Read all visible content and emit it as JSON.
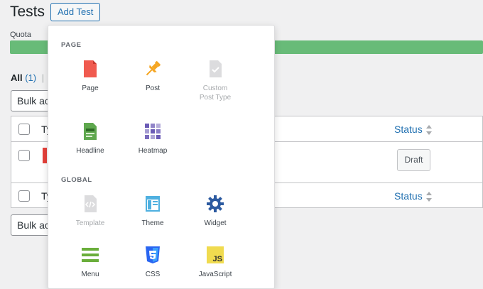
{
  "page": {
    "title": "Tests",
    "add_button": "Add Test",
    "quota_label": "Quota",
    "filters": {
      "all": "All",
      "count": "(1)",
      "separator": "|"
    },
    "bulk_label": "Bulk ac"
  },
  "table": {
    "col_type": "Ty",
    "col_status": "Status",
    "row_status": "Draft"
  },
  "dropdown": {
    "sections": [
      {
        "title": "PAGE",
        "items": [
          {
            "label": "Page",
            "icon": "page-icon",
            "color": "#f05a4f"
          },
          {
            "label": "Post",
            "icon": "pushpin-icon",
            "color": "#f5a623"
          },
          {
            "label": "Custom\nPost Type",
            "icon": "custom-post-type-icon",
            "color": "#dcdcde",
            "disabled": true
          },
          {
            "label": "Headline",
            "icon": "headline-icon",
            "color": "#5fa84e"
          },
          {
            "label": "Heatmap",
            "icon": "heatmap-icon",
            "color": "#6b5bb6"
          }
        ]
      },
      {
        "title": "GLOBAL",
        "items": [
          {
            "label": "Template",
            "icon": "template-icon",
            "color": "#dcdcde",
            "disabled": true
          },
          {
            "label": "Theme",
            "icon": "theme-icon",
            "color": "#4fb0e0"
          },
          {
            "label": "Widget",
            "icon": "gear-icon",
            "color": "#2c5aa0"
          },
          {
            "label": "Menu",
            "icon": "menu-icon",
            "color": "#6aae3b"
          },
          {
            "label": "CSS",
            "icon": "css3-icon",
            "color": "#2965f1"
          },
          {
            "label": "JavaScript",
            "icon": "js-icon",
            "color": "#f0db4f"
          }
        ]
      }
    ]
  }
}
